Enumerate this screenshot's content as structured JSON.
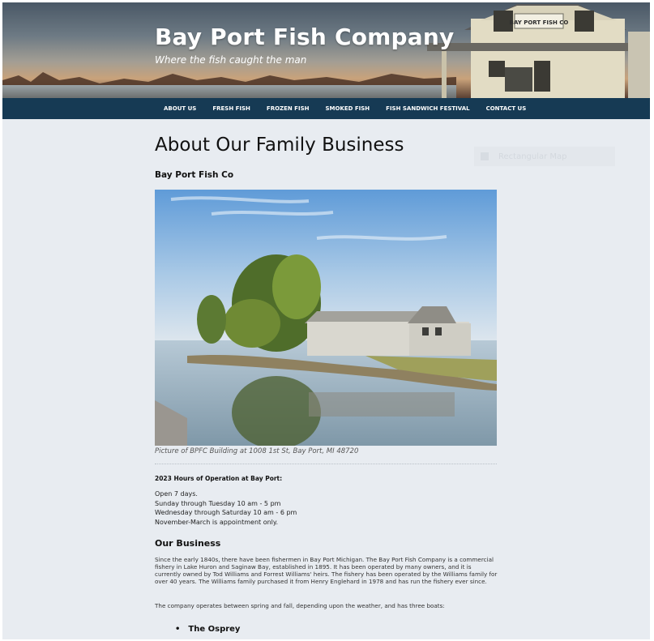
{
  "site": {
    "title": "Bay Port Fish Company",
    "tagline": "Where the fish caught the man",
    "building_sign": "BAY PORT FISH CO"
  },
  "nav": {
    "items": [
      {
        "label": "About Us"
      },
      {
        "label": "Fresh Fish"
      },
      {
        "label": "Frozen Fish"
      },
      {
        "label": "Smoked Fish"
      },
      {
        "label": "Fish Sandwich Festival"
      },
      {
        "label": "Contact Us"
      }
    ]
  },
  "main": {
    "page_title": "About Our Family Business",
    "subheading": "Bay Port Fish Co",
    "photo_caption": "Picture of BPFC Building at 1008 1st St, Bay Port, MI 48720",
    "hours": {
      "heading": "2023 Hours of Operation at Bay Port:",
      "lines": [
        "Open 7 days.",
        "Sunday through Tuesday 10 am - 5 pm",
        "Wednesday through Saturday 10 am - 6 pm",
        "November-March is appointment only."
      ]
    },
    "business": {
      "heading": "Our Business",
      "paragraph": "Since the early 1840s, there have been fishermen in Bay Port Michigan. The Bay Port Fish Company is a commercial fishery in Lake Huron and Saginaw Bay, established in 1895. It has been operated by many owners, and it is currently owned by Tod Williams and Forrest Williams' heirs. The fishery has been operated by the Williams family for over 40 years. The Williams family purchased it from Henry Englehard in 1978 and has run the fishery ever since.",
      "boats_intro": "The company operates between spring and fall, depending upon the weather, and has three boats:",
      "boats": [
        "The Osprey"
      ]
    }
  },
  "sidebar": {
    "widget_label": "Rectangular Map"
  },
  "colors": {
    "nav_bg": "#163a54",
    "page_bg": "#e8ecf1",
    "text": "#111111"
  }
}
